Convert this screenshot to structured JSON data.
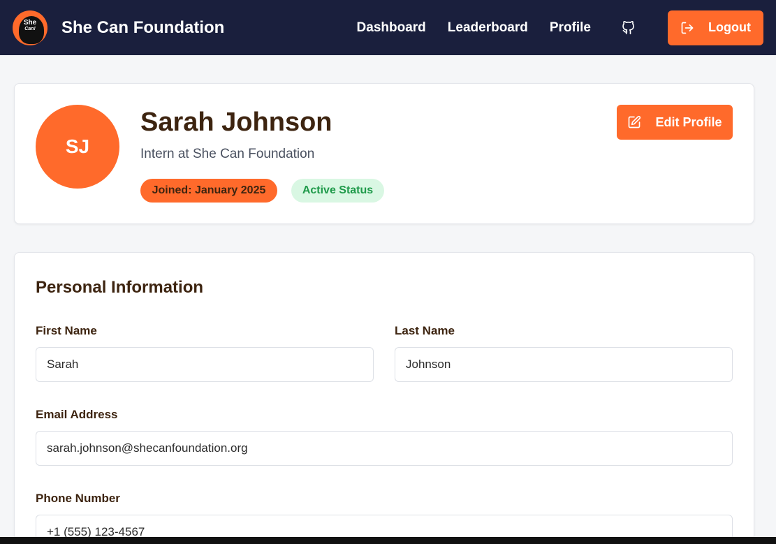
{
  "navbar": {
    "logo_text_line1": "She",
    "logo_text_line2": "Can!",
    "brand": "She Can Foundation",
    "links": [
      "Dashboard",
      "Leaderboard",
      "Profile"
    ],
    "github_icon": "github-icon",
    "logout_label": "Logout",
    "logout_icon": "logout-icon"
  },
  "profile": {
    "initials": "SJ",
    "name": "Sarah Johnson",
    "role": "Intern at She Can Foundation",
    "joined_badge": "Joined: January 2025",
    "status_badge": "Active Status",
    "edit_label": "Edit Profile",
    "edit_icon": "edit-icon"
  },
  "personal_info": {
    "title": "Personal Information",
    "first_name_label": "First Name",
    "first_name_value": "Sarah",
    "last_name_label": "Last Name",
    "last_name_value": "Johnson",
    "email_label": "Email Address",
    "email_value": "sarah.johnson@shecanfoundation.org",
    "phone_label": "Phone Number",
    "phone_value": "+1 (555) 123-4567"
  },
  "colors": {
    "navbar_bg": "#1a1f3d",
    "accent": "#ff6a2b",
    "heading_text": "#3d2410",
    "status_green": "#1f9a4a",
    "status_green_bg": "#d9f7e3"
  }
}
